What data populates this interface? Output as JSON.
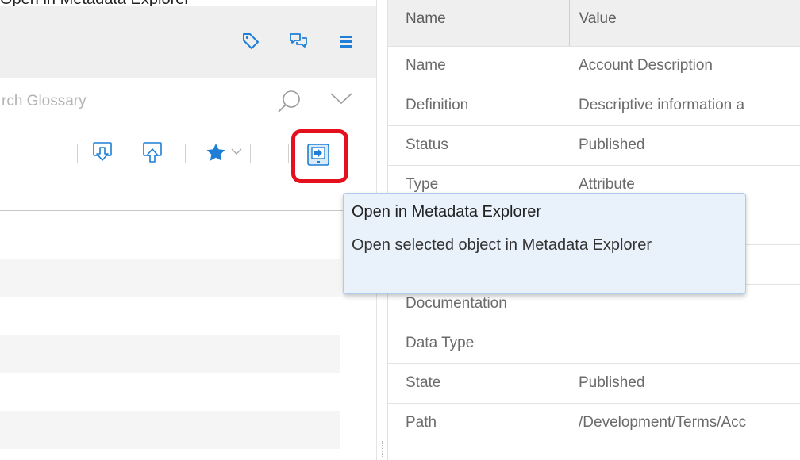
{
  "top_fragment": "Open in Metadata Explorer",
  "left_panel": {
    "header_icons": [
      "tag-icon",
      "comments-icon",
      "menu-icon"
    ],
    "search": {
      "placeholder": "Search Glossary",
      "visible_text": "rch Glossary"
    },
    "toolbar_icons": [
      "import-icon",
      "export-icon",
      "favorite-star-icon",
      "favorite-dropdown-icon",
      "open-in-metadata-explorer-icon"
    ]
  },
  "properties": {
    "headers": {
      "name": "Name",
      "value": "Value"
    },
    "rows": [
      {
        "name": "Name",
        "value": "Account Description"
      },
      {
        "name": "Definition",
        "value": "Descriptive information a"
      },
      {
        "name": "Status",
        "value": "Published"
      },
      {
        "name": "Type",
        "value": "Attribute"
      },
      {
        "name": "",
        "value": ""
      },
      {
        "name": "",
        "value": ""
      },
      {
        "name": "Documentation",
        "value": ""
      },
      {
        "name": "Data Type",
        "value": ""
      },
      {
        "name": "State",
        "value": "Published"
      },
      {
        "name": "Path",
        "value": "/Development/Terms/Acc"
      }
    ]
  },
  "tooltip": {
    "title": "Open in Metadata Explorer",
    "body": "Open selected object in Metadata Explorer"
  },
  "colors": {
    "accent_blue": "#1f7fd6",
    "highlight_red": "#e4101e",
    "tooltip_bg": "#e9f1fb"
  }
}
